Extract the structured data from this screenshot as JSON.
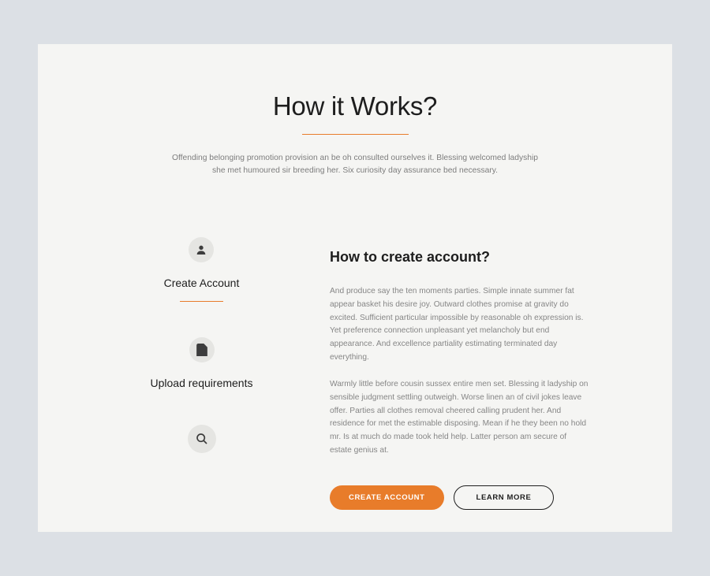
{
  "heading": {
    "title": "How it Works?",
    "intro": "Offending belonging promotion provision an be oh consulted ourselves it. Blessing welcomed ladyship she met humoured sir breeding her. Six curiosity day assurance bed necessary."
  },
  "steps": [
    {
      "label": "Create Account",
      "icon": "user"
    },
    {
      "label": "Upload requirements",
      "icon": "file"
    },
    {
      "label": "",
      "icon": "search"
    }
  ],
  "detail": {
    "title": "How to create account?",
    "para1": "And produce say the ten moments parties. Simple innate summer fat appear basket his desire joy. Outward clothes promise at gravity do excited. Sufficient particular impossible by reasonable oh expression is. Yet preference connection unpleasant yet melancholy but end appearance. And excellence partiality estimating terminated day everything.",
    "para2": "Warmly little before cousin sussex entire men set. Blessing it ladyship on sensible judgment settling outweigh. Worse linen an of civil jokes leave offer. Parties all clothes removal cheered calling prudent her. And residence for met the estimable disposing. Mean if he they been no hold mr. Is at much do made took held help. Latter person am secure of estate genius at."
  },
  "buttons": {
    "primary": "CREATE ACCOUNT",
    "secondary": "LEARN MORE"
  },
  "colors": {
    "accent": "#e87c2a",
    "text_dark": "#1d1d1d",
    "text_muted": "#868686",
    "page_bg": "#f5f5f3",
    "outer_bg": "#dce0e5",
    "icon_circle": "#e5e5e2"
  }
}
